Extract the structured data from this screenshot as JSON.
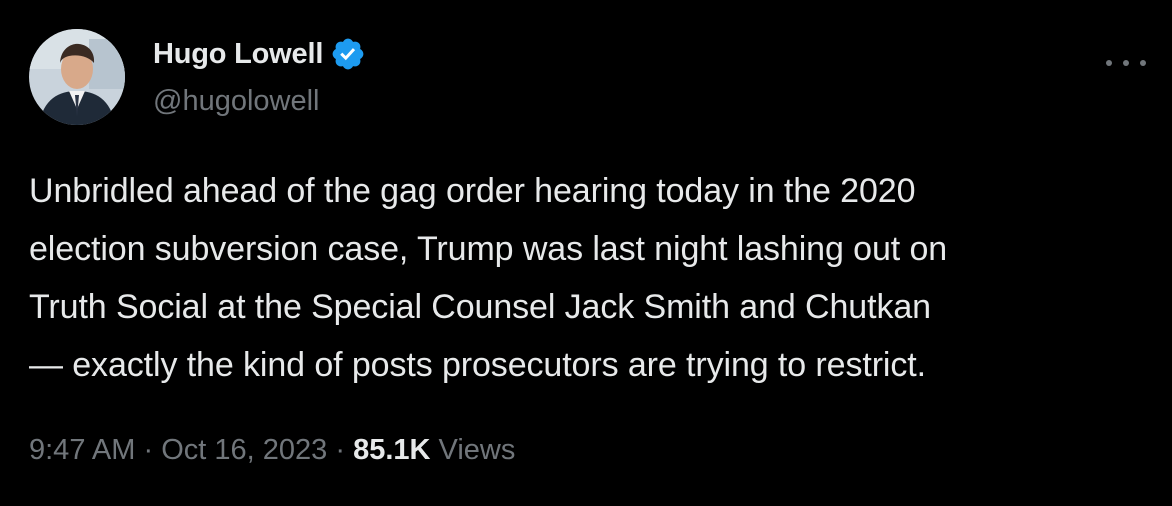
{
  "author": {
    "display_name": "Hugo Lowell",
    "handle": "@hugolowell",
    "verified_badge_icon": "verified-badge-icon",
    "verified_color": "#1d9bf0"
  },
  "tweet": {
    "lines": [
      "Unbridled ahead of the gag order hearing today in the 2020",
      "election subversion case, Trump was last night lashing out on",
      "Truth Social at the Special Counsel Jack Smith and Chutkan",
      "— exactly the kind of posts prosecutors are trying to restrict."
    ]
  },
  "meta": {
    "time": "9:47 AM",
    "separator": "·",
    "date": "Oct 16, 2023",
    "views_count": "85.1K",
    "views_label": "Views"
  },
  "icons": {
    "more": "more-options-icon"
  },
  "colors": {
    "background": "#000000",
    "primary_text": "#e7e9ea",
    "secondary_text": "#71767b",
    "accent": "#1d9bf0"
  }
}
